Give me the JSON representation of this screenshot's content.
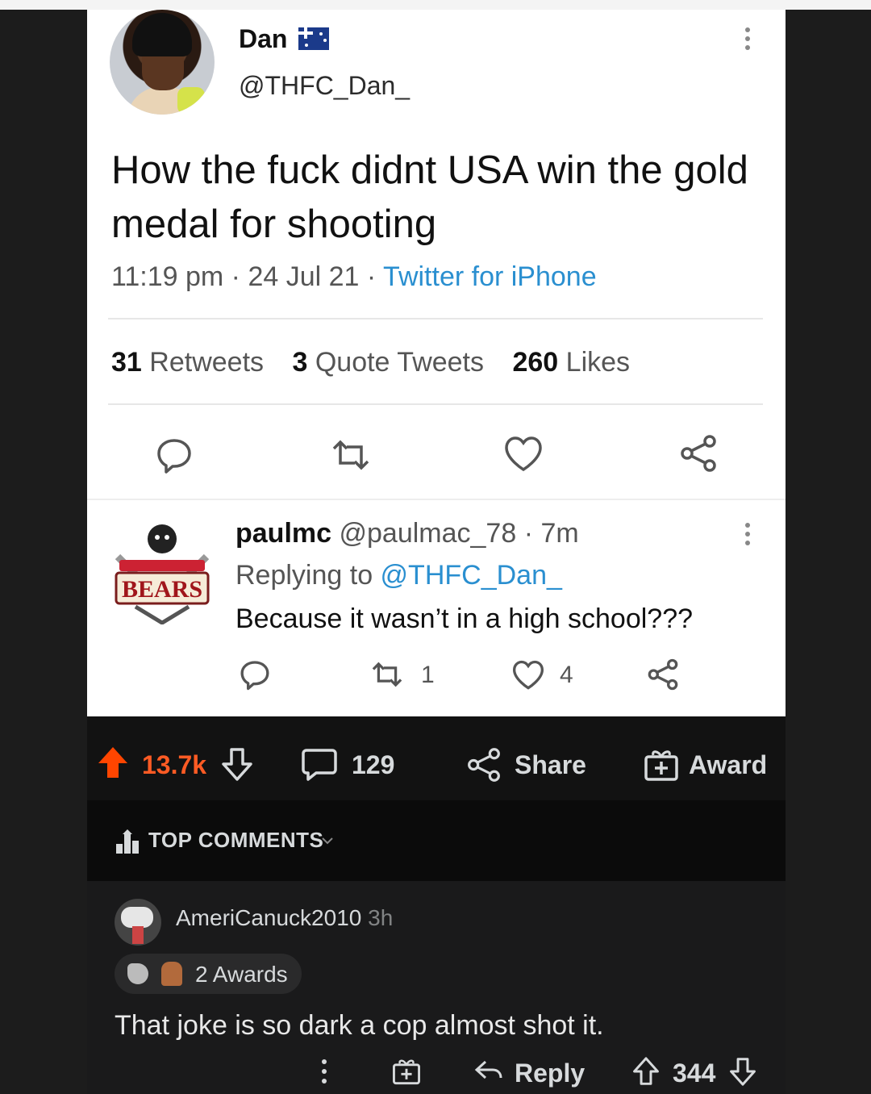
{
  "tweet": {
    "name": "Dan",
    "handle": "@THFC_Dan_",
    "text": "How the fuck didnt USA win the gold medal for shooting",
    "time": "11:19 pm · 24 Jul 21 · ",
    "source": "Twitter for iPhone",
    "stats": {
      "retweets_count": "31",
      "retweets_label": "Retweets",
      "quotes_count": "3",
      "quotes_label": "Quote Tweets",
      "likes_count": "260",
      "likes_label": "Likes"
    }
  },
  "reply": {
    "name": "paulmc",
    "meta": " @paulmac_78 · 7m",
    "replying_prefix": "Replying to ",
    "replying_handle": "@THFC_Dan_",
    "text": "Because it wasn’t in a high school???",
    "retweets": "1",
    "likes": "4"
  },
  "post_bar": {
    "upvotes": "13.7k",
    "comments": "129",
    "share_label": "Share",
    "award_label": "Award"
  },
  "comments_header": {
    "label": "TOP COMMENTS"
  },
  "comment": {
    "user": "AmeriCanuck2010",
    "age": " 3h",
    "awards": "2 Awards",
    "text": "That joke is so dark a cop almost shot it.",
    "reply_label": "Reply",
    "score": "344"
  },
  "colors": {
    "upvote": "#ff4500",
    "link": "#2a8fd0"
  }
}
